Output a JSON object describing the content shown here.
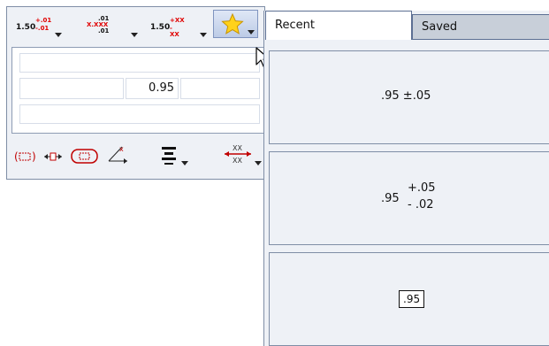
{
  "editor": {
    "toolbar": {
      "btn1": {
        "base": "1.50",
        "upper": "+.01",
        "lower": "-.01"
      },
      "btn2": {
        "top": ".01",
        "main": "X.XXX",
        "bottom": ".01"
      },
      "btn3": {
        "base": "1.50",
        "upper": "+XX",
        "lower": "-XX"
      },
      "favorites_icon": "star-icon"
    },
    "fields": {
      "value": "0.95"
    }
  },
  "popup": {
    "tabs": [
      {
        "label": "Recent"
      },
      {
        "label": "Saved"
      }
    ],
    "items": [
      {
        "text": ".95 ±.05"
      },
      {
        "base": ".95",
        "upper": "+.05",
        "lower": "- .02"
      },
      {
        "text": ".95"
      }
    ]
  },
  "colors": {
    "accent_red": "#e00000",
    "panel_bg": "#eef1f6",
    "border": "#7f8ea6"
  }
}
